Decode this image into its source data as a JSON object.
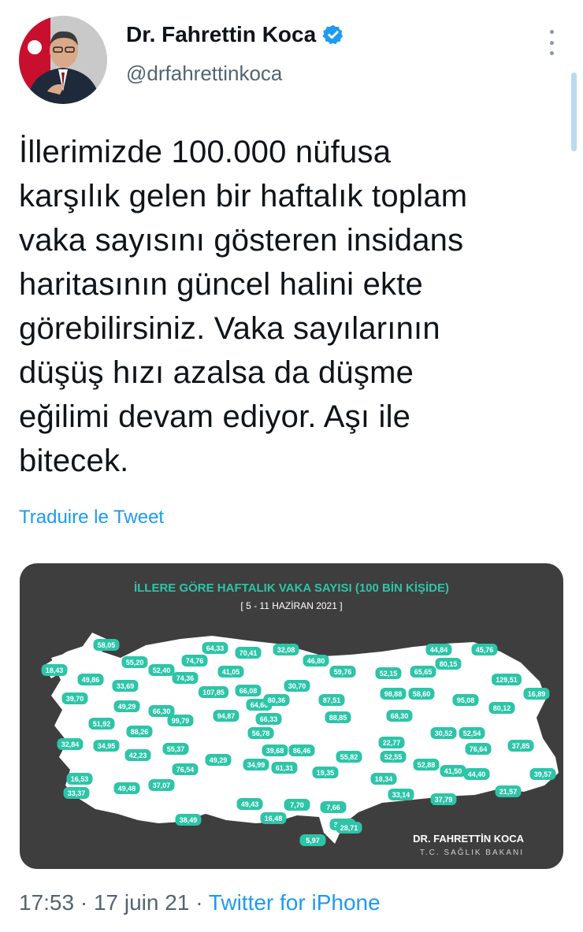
{
  "author": {
    "display_name": "Dr. Fahrettin Koca",
    "handle": "@drfahrettinkoca",
    "verified": true,
    "avatar_icon": "profile-photo"
  },
  "tweet": {
    "lines": [
      "İllerimizde 100.000 nüfusa",
      "karşılık gelen bir haftalık toplam",
      "vaka sayısını gösteren insidans",
      "haritasının güncel halini ekte",
      "görebilirsiniz. Vaka sayılarının",
      "düşüş hızı azalsa da düşme",
      "eğilimi devam ediyor. Aşı ile",
      "bitecek."
    ],
    "translate_label": "Traduire le Tweet"
  },
  "media": {
    "title": "İLLERE GÖRE HAFTALIK VAKA SAYISI (100 BİN KİŞİDE)",
    "subtitle": "[ 5 - 11 HAZİRAN 2021 ]",
    "signature_name": "DR. FAHRETTİN KOCA",
    "signature_title": "T.C. SAĞLIK BAKANI",
    "colors": {
      "background": "#3e3e3e",
      "map": "#ffffff",
      "badge": "#2ec4a8",
      "title": "#2ec4a8"
    },
    "province_values": [
      "58,05",
      "55,20",
      "52,40",
      "74,76",
      "64,33",
      "70,41",
      "32,08",
      "46,80",
      "44,84",
      "45,76",
      "18,43",
      "49,86",
      "33,69",
      "74,36",
      "41,05",
      "107,85",
      "66,08",
      "30,70",
      "59,76",
      "52,15",
      "65,65",
      "80,15",
      "129,51",
      "39,70",
      "49,29",
      "66,30",
      "64,60",
      "80,36",
      "87,51",
      "98,88",
      "58,60",
      "95,08",
      "16,89",
      "51,92",
      "88,26",
      "99,79",
      "94,87",
      "66,33",
      "88,85",
      "68,30",
      "80,12",
      "32,84",
      "34,95",
      "42,23",
      "55,37",
      "56,78",
      "39,68",
      "86,46",
      "55,82",
      "22,77",
      "30,52",
      "52,54",
      "76,64",
      "37,85",
      "16,53",
      "49,48",
      "37,07",
      "76,54",
      "49,29",
      "34,99",
      "61,31",
      "19,35",
      "52,55",
      "18,34",
      "52,88",
      "41,50",
      "44,40",
      "39,57",
      "33,37",
      "38,49",
      "49,43",
      "16,48",
      "7,70",
      "7,66",
      "37,84",
      "33,14",
      "37,79",
      "21,57",
      "28,71",
      "5,97"
    ]
  },
  "meta": {
    "time": "17:53",
    "separator": "·",
    "date": "17 juin 21",
    "source": "Twitter for iPhone"
  }
}
